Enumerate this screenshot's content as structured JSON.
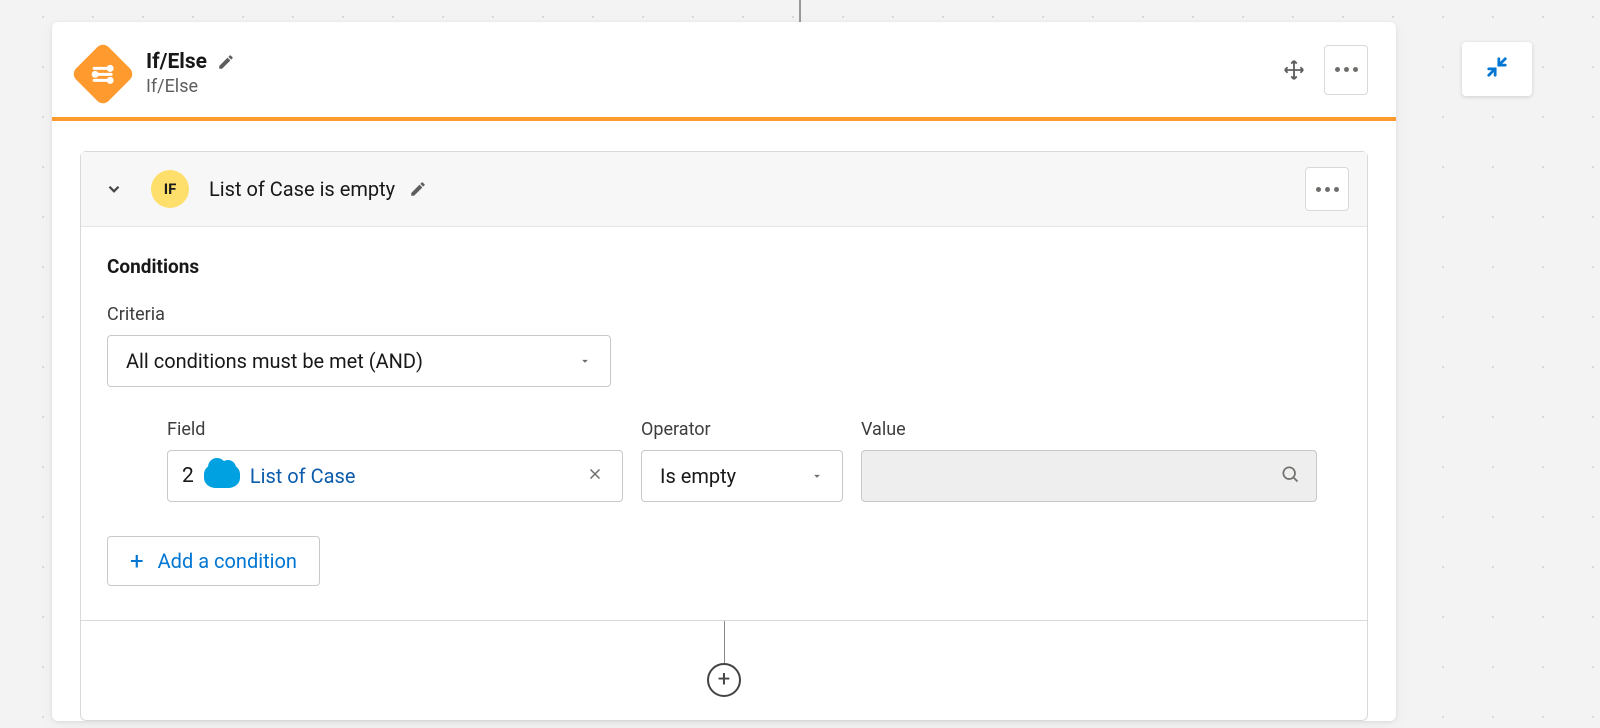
{
  "header": {
    "title": "If/Else",
    "subtitle": "If/Else"
  },
  "section": {
    "badge": "IF",
    "title": "List of Case is empty",
    "conditions_label": "Conditions",
    "criteria_label": "Criteria",
    "criteria_value": "All conditions must be met (AND)",
    "field_label": "Field",
    "operator_label": "Operator",
    "value_label": "Value",
    "field_chip_number": "2",
    "field_chip_text": "List of Case",
    "operator_value": "Is empty",
    "add_condition": "Add a condition"
  }
}
